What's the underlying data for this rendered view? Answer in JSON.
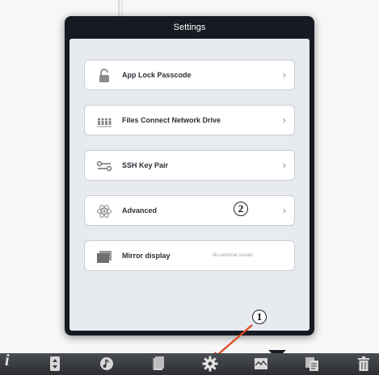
{
  "popover": {
    "title": "Settings"
  },
  "settings_items": [
    {
      "label": "App Lock Passcode",
      "icon": "padlock-icon"
    },
    {
      "label": "Files Connect Network Drive",
      "icon": "network-users-icon"
    },
    {
      "label": "SSH Key Pair",
      "icon": "key-pair-icon"
    },
    {
      "label": "Advanced",
      "icon": "atom-icon"
    },
    {
      "label": "Mirror display",
      "value": "No external screen",
      "icon": "display-icon"
    }
  ],
  "annotations": {
    "marker_1": "1",
    "marker_2": "2",
    "arrow_color": "#e04a24"
  },
  "toolbar": {
    "items": [
      "info-icon",
      "sort-icon",
      "music-note-icon",
      "books-icon",
      "gear-icon",
      "image-icon",
      "copy-icon",
      "trash-icon"
    ],
    "info_glyph": "i"
  },
  "colors": {
    "popover_frame": "#161a22",
    "popover_body": "#e7eaef",
    "toolbar": "#3a3c40"
  }
}
